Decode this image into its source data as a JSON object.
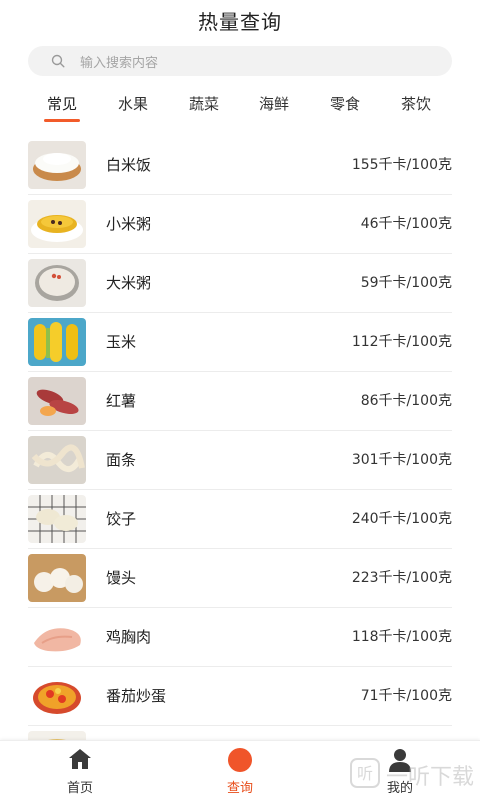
{
  "header": {
    "title": "热量查询"
  },
  "search": {
    "placeholder": "输入搜索内容",
    "icon": "search-icon"
  },
  "tabs": [
    {
      "label": "常见",
      "active": true
    },
    {
      "label": "水果",
      "active": false
    },
    {
      "label": "蔬菜",
      "active": false
    },
    {
      "label": "海鲜",
      "active": false
    },
    {
      "label": "零食",
      "active": false
    },
    {
      "label": "茶饮",
      "active": false
    }
  ],
  "accent_color": "#f25b2a",
  "foods": [
    {
      "name": "白米饭",
      "calories": "155千卡/100克",
      "icon": "rice-bowl-icon"
    },
    {
      "name": "小米粥",
      "calories": "46千卡/100克",
      "icon": "millet-porridge-icon"
    },
    {
      "name": "大米粥",
      "calories": "59千卡/100克",
      "icon": "rice-porridge-icon"
    },
    {
      "name": "玉米",
      "calories": "112千卡/100克",
      "icon": "corn-icon"
    },
    {
      "name": "红薯",
      "calories": "86千卡/100克",
      "icon": "sweet-potato-icon"
    },
    {
      "name": "面条",
      "calories": "301千卡/100克",
      "icon": "noodles-icon"
    },
    {
      "name": "饺子",
      "calories": "240千卡/100克",
      "icon": "dumplings-icon"
    },
    {
      "name": "馒头",
      "calories": "223千卡/100克",
      "icon": "steamed-bun-icon"
    },
    {
      "name": "鸡胸肉",
      "calories": "118千卡/100克",
      "icon": "chicken-breast-icon"
    },
    {
      "name": "番茄炒蛋",
      "calories": "71千卡/100克",
      "icon": "tomato-egg-icon"
    }
  ],
  "tabbar": {
    "items": [
      {
        "label": "首页",
        "icon": "home-icon",
        "active": false
      },
      {
        "label": "查询",
        "icon": "query-dot-icon",
        "active": true
      },
      {
        "label": "我的",
        "icon": "user-icon",
        "active": false
      }
    ]
  },
  "watermark": {
    "text": "一听下载"
  }
}
